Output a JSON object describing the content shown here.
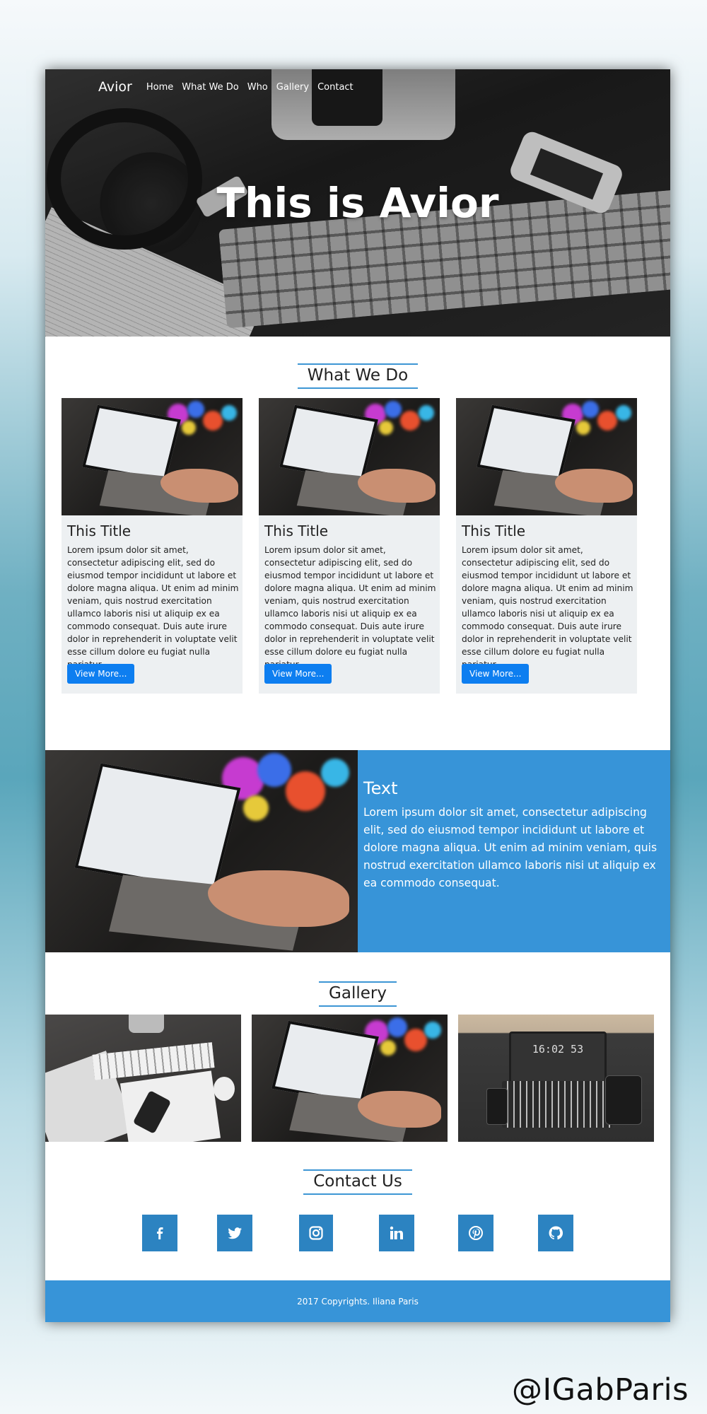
{
  "nav": {
    "brand": "Avior",
    "links": [
      "Home",
      "What We Do",
      "Who",
      "Gallery",
      "Contact"
    ]
  },
  "hero": {
    "title": "This is Avior"
  },
  "what_we_do": {
    "title": "What We Do",
    "cards": [
      {
        "title": "This Title",
        "text": "Lorem ipsum dolor sit amet, consectetur adipiscing elit, sed do eiusmod tempor incididunt ut labore et dolore magna aliqua. Ut enim ad minim veniam, quis nostrud exercitation ullamco laboris nisi ut aliquip ex ea commodo consequat. Duis aute irure dolor in reprehenderit in voluptate velit esse cillum dolore eu fugiat nulla pariatur.",
        "button": "View More..."
      },
      {
        "title": "This Title",
        "text": "Lorem ipsum dolor sit amet, consectetur adipiscing elit, sed do eiusmod tempor incididunt ut labore et dolore magna aliqua. Ut enim ad minim veniam, quis nostrud exercitation ullamco laboris nisi ut aliquip ex ea commodo consequat. Duis aute irure dolor in reprehenderit in voluptate velit esse cillum dolore eu fugiat nulla pariatur.",
        "button": "View More..."
      },
      {
        "title": "This Title",
        "text": "Lorem ipsum dolor sit amet, consectetur adipiscing elit, sed do eiusmod tempor incididunt ut labore et dolore magna aliqua. Ut enim ad minim veniam, quis nostrud exercitation ullamco laboris nisi ut aliquip ex ea commodo consequat. Duis aute irure dolor in reprehenderit in voluptate velit esse cillum dolore eu fugiat nulla pariatur.",
        "button": "View More..."
      }
    ]
  },
  "feature": {
    "title": "Text",
    "text": "Lorem ipsum dolor sit amet, consectetur adipiscing elit, sed do eiusmod tempor incididunt ut labore et dolore magna aliqua. Ut enim ad minim veniam, quis nostrud exercitation ullamco laboris nisi ut aliquip ex ea commodo consequat."
  },
  "gallery": {
    "title": "Gallery",
    "laptop_clock": "16:02 53"
  },
  "contact": {
    "title": "Contact Us",
    "social_icons": [
      "facebook-icon",
      "twitter-icon",
      "instagram-icon",
      "linkedin-icon",
      "pinterest-icon",
      "github-icon"
    ]
  },
  "footer": {
    "text": "2017 Copyrights. Iliana Paris"
  },
  "watermark": "@IGabParis",
  "colors": {
    "accent_blue": "#3794d8",
    "button_blue": "#0d7ef0",
    "social_blue": "#2c83c1",
    "card_bg": "#edf0f2"
  }
}
